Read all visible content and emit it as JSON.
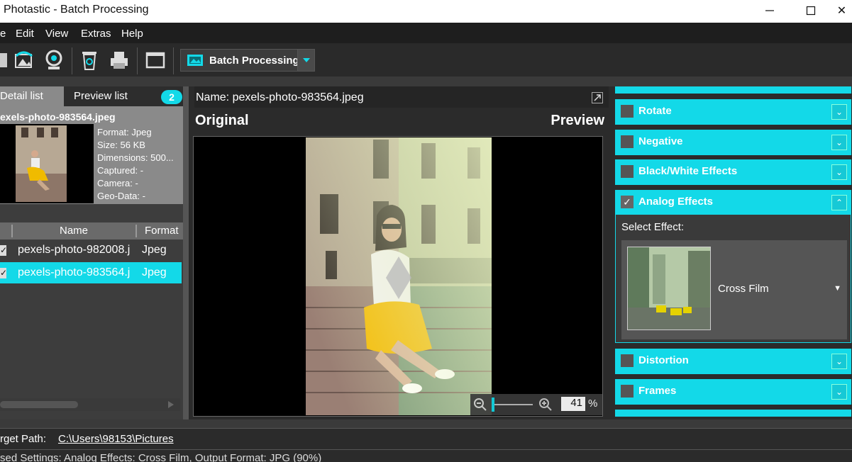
{
  "window": {
    "title": "Photastic - Batch Processing"
  },
  "menu": [
    "e",
    "Edit",
    "View",
    "Extras",
    "Help"
  ],
  "toolbar": {
    "batch_label": "Batch Processing"
  },
  "left": {
    "tab_detail": "Detail list",
    "tab_preview": "Preview list",
    "count": "2",
    "selected_file": "exels-photo-983564.jpeg",
    "meta": [
      "Format: Jpeg",
      "Size: 56 KB",
      "Dimensions: 500...",
      "Captured: -",
      "Camera: -",
      "Geo-Data: -"
    ],
    "columns": {
      "name": "Name",
      "format": "Format"
    },
    "rows": [
      {
        "name": "pexels-photo-982008.j",
        "format": "Jpeg"
      },
      {
        "name": "pexels-photo-983564.j",
        "format": "Jpeg"
      }
    ]
  },
  "center": {
    "name_label": "Name: pexels-photo-983564.jpeg",
    "original": "Original",
    "preview": "Preview",
    "zoom": "41",
    "zoom_unit": "%"
  },
  "right": {
    "sections": [
      "Rotate",
      "Negative",
      "Black/White Effects",
      "Analog Effects",
      "Distortion",
      "Frames"
    ],
    "select_effect": "Select Effect:",
    "effect_name": "Cross Film"
  },
  "bottom": {
    "target_label": "rget Path:",
    "target_value": "C:\\Users\\98153\\Pictures",
    "status": "sed Settings: Analog Effects: Cross Film, Output Format: JPG (90%)"
  },
  "colors": {
    "accent": "#13d9e8",
    "bg": "#2b2b2b"
  }
}
